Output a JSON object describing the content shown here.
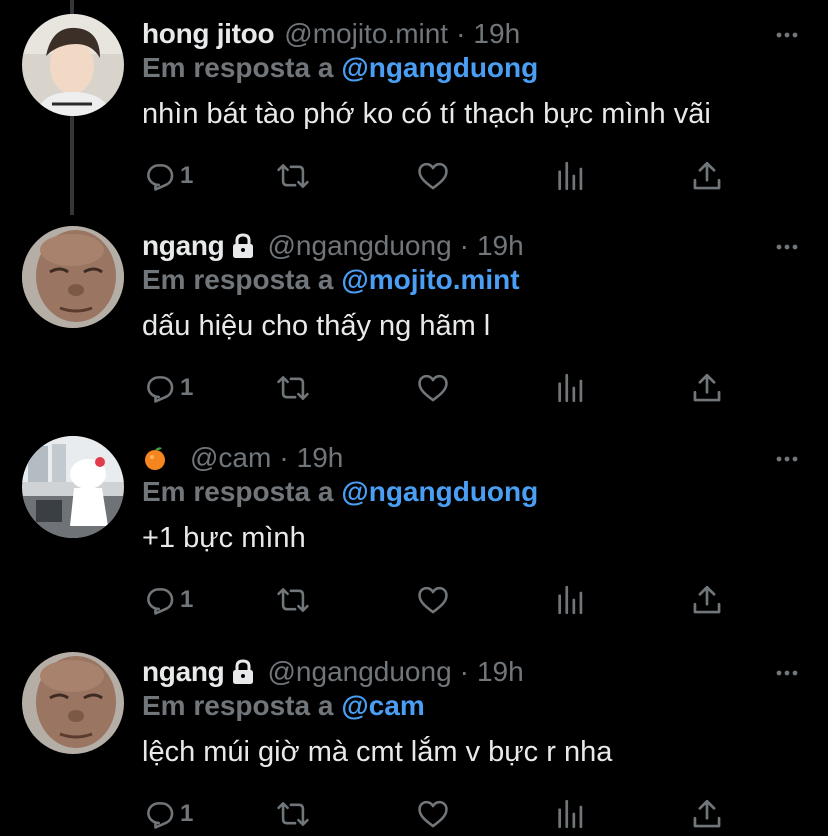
{
  "reply_prefix": "Em resposta a",
  "tweets": [
    {
      "display_name": "hong jitoo",
      "handle": "@mojito.mint",
      "dot": "·",
      "time": "19h",
      "reply_to": "@ngangduong",
      "text": "nhìn bát tào phớ ko có tí thạch bực mình vãi",
      "reply_count": "1",
      "locked": false,
      "avatar": "young-person-photo"
    },
    {
      "display_name": "ngang",
      "handle": "@ngangduong",
      "dot": "·",
      "time": "19h",
      "reply_to": "@mojito.mint",
      "text": "dấu hiệu cho thấy ng hãm l",
      "reply_count": "1",
      "locked": true,
      "avatar": "bald-man-photo"
    },
    {
      "display_name": "",
      "handle": "@cam",
      "dot": "·",
      "time": "19h",
      "reply_to": "@ngangduong",
      "text": "+1 bực mình",
      "reply_count": "1",
      "locked": false,
      "avatar": "hello-kitty-photo",
      "name_emoji": "orange-fruit-icon"
    },
    {
      "display_name": "ngang",
      "handle": "@ngangduong",
      "dot": "·",
      "time": "19h",
      "reply_to": "@cam",
      "text": "lệch múi giờ mà cmt lắm v bực r nha",
      "reply_count": "1",
      "locked": true,
      "avatar": "bald-man-photo"
    }
  ],
  "colors": {
    "background": "#000000",
    "text_primary": "#e7e9ea",
    "text_secondary": "#71767b",
    "mention": "#4a9ff5",
    "thread_line": "#333639"
  }
}
